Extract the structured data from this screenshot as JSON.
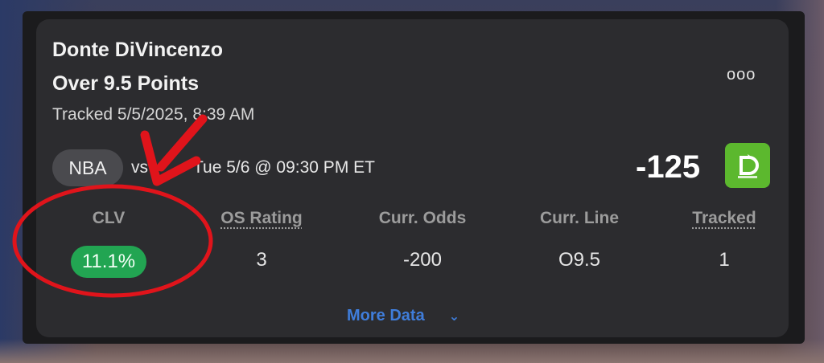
{
  "bet": {
    "player": "Donte DiVincenzo",
    "market": "Over 9.5 Points",
    "tracked": "Tracked 5/5/2025, 8:39 AM",
    "more_menu": "ooo",
    "league": "NBA",
    "vs": "vs",
    "game_time": "Tue 5/6 @ 09:30 PM ET",
    "odds": "-125",
    "book_icon": "sportsbook-logo-icon"
  },
  "stats": [
    {
      "label": "CLV",
      "value": "11.1%"
    },
    {
      "label": "OS Rating",
      "value": "3"
    },
    {
      "label": "Curr. Odds",
      "value": "-200"
    },
    {
      "label": "Curr. Line",
      "value": "O9.5"
    },
    {
      "label": "Tracked",
      "value": "1"
    }
  ],
  "footer": {
    "more_data": "More Data",
    "chevron_icon": "chevron-down-icon"
  },
  "colors": {
    "card": "#2c2c2f",
    "clv_green": "#22a552",
    "link_blue": "#3f7ddb",
    "annotation_red": "#e0141b",
    "book_green": "#5cb82e"
  }
}
